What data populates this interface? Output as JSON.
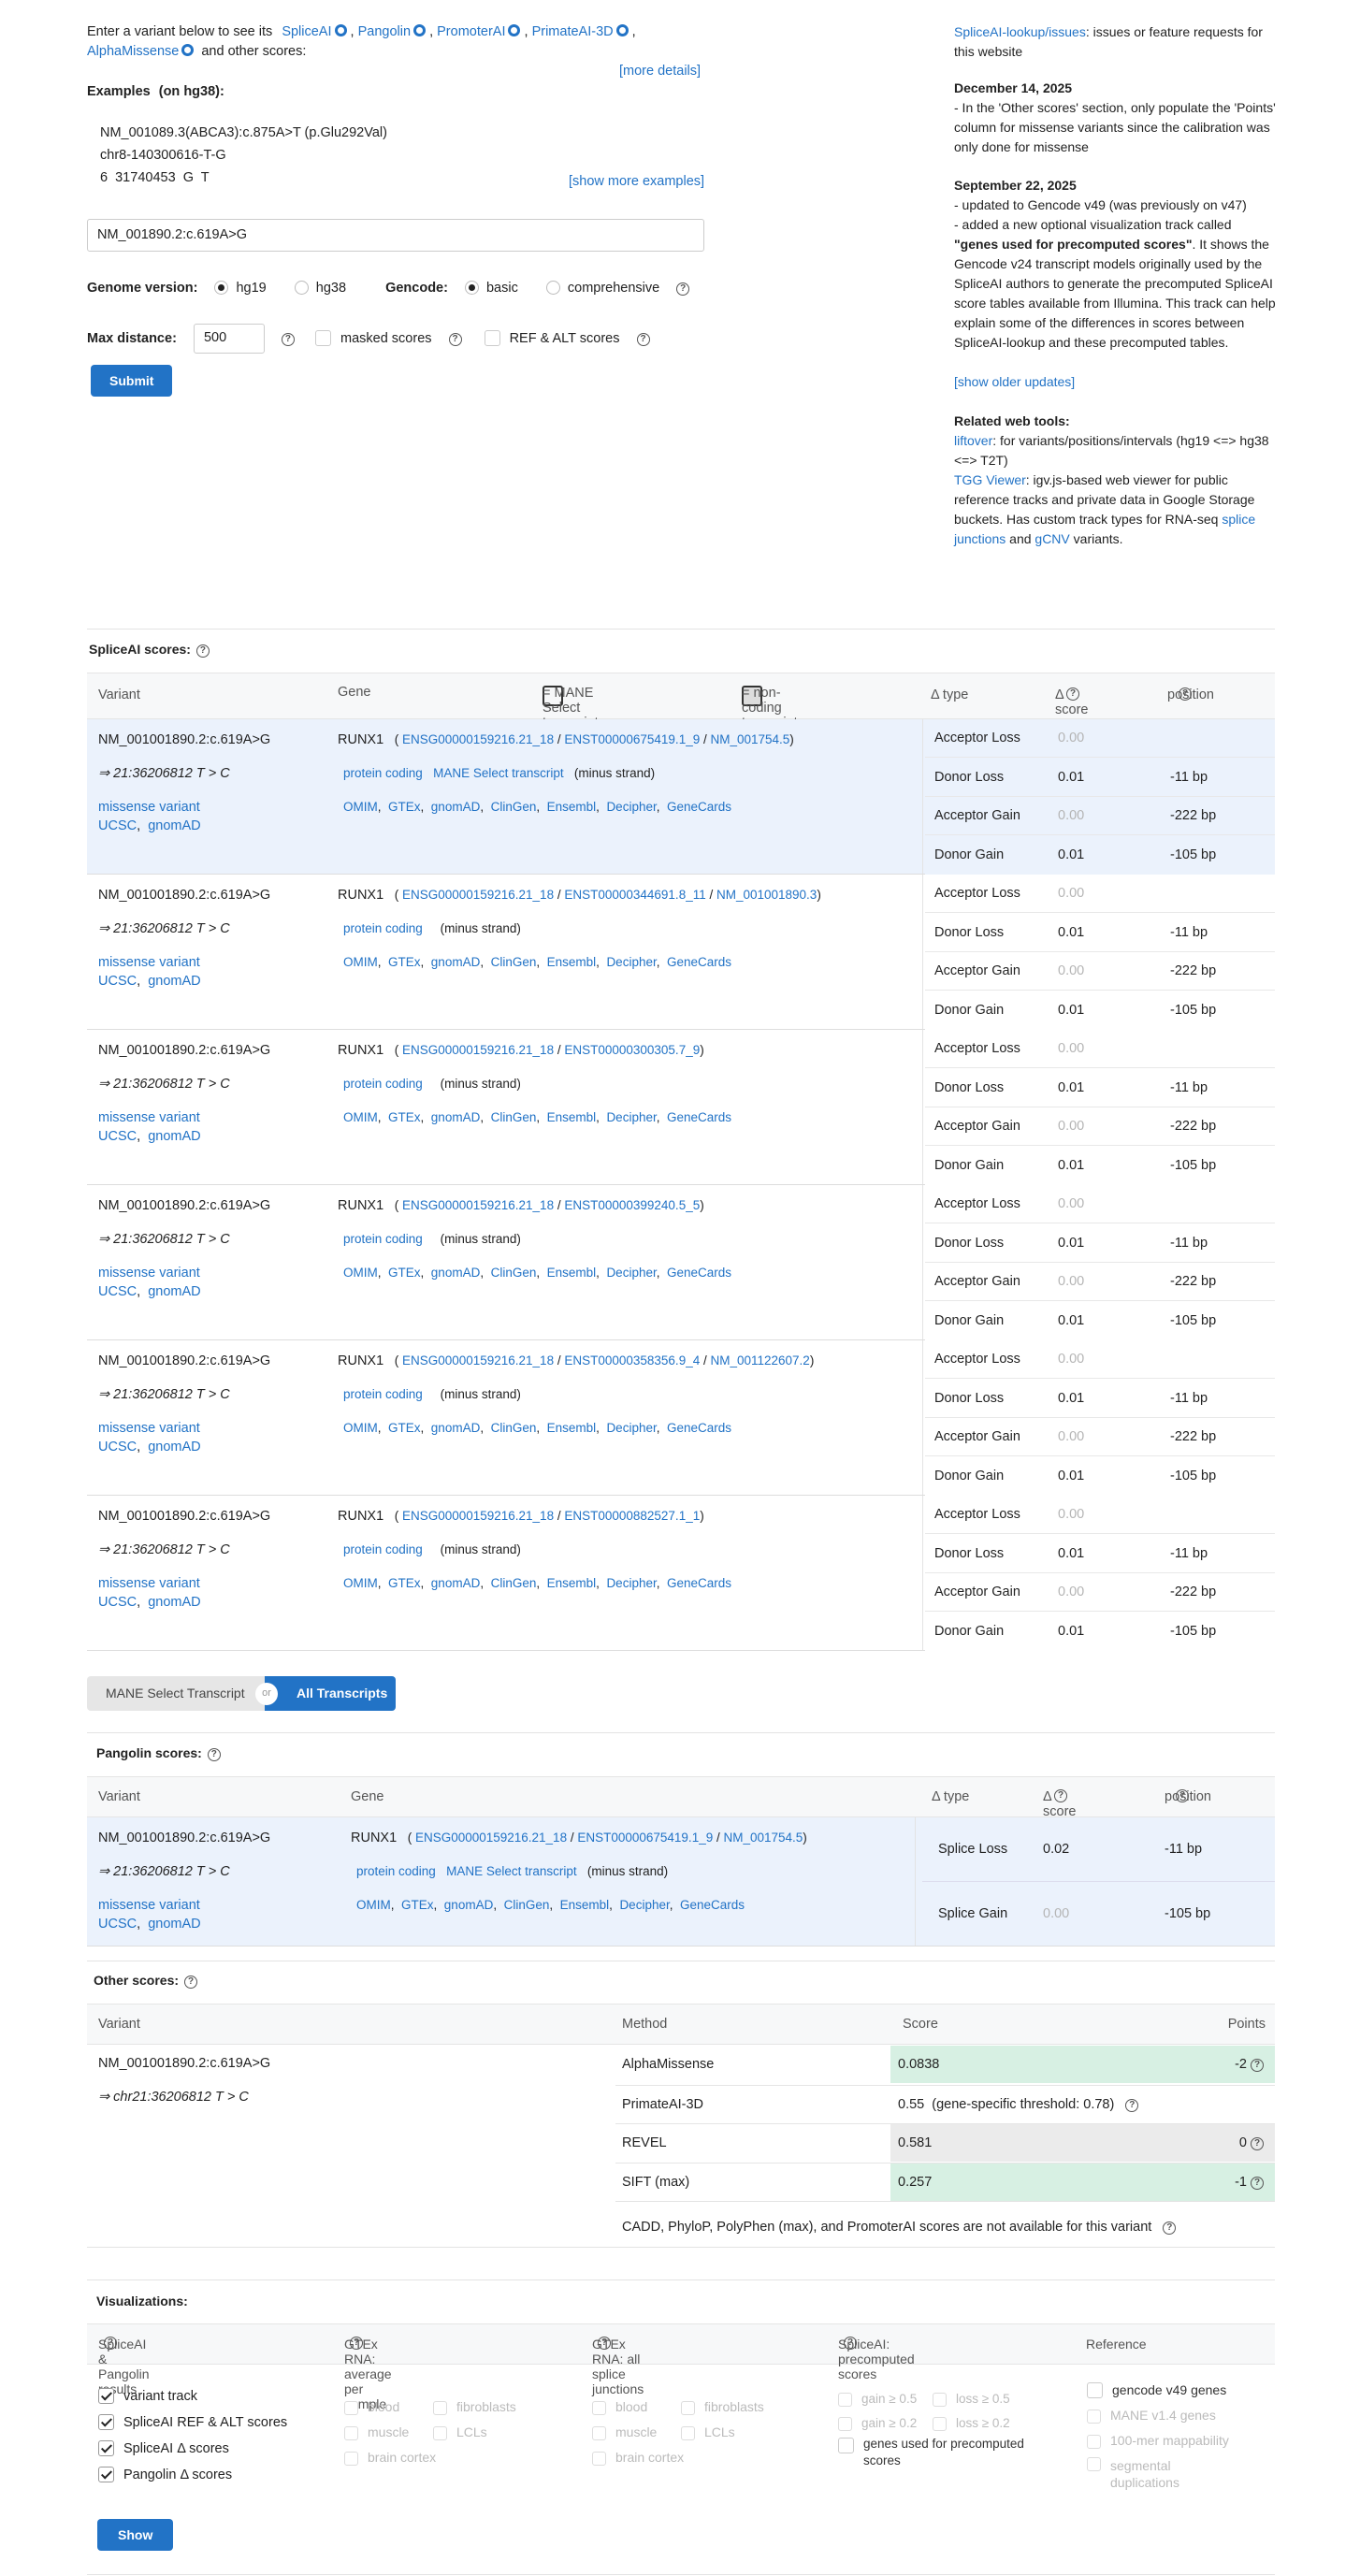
{
  "intro": {
    "prefix": "Enter a variant below to see its",
    "tools": [
      "SpliceAI",
      "Pangolin",
      "PromoterAI",
      "PrimateAI-3D",
      "AlphaMissense"
    ],
    "suffix": "and other scores:",
    "more_details": "[more details]"
  },
  "examples": {
    "heading": "Examples",
    "heading_note": "(on hg38):",
    "items": [
      "NM_001089.3(ABCA3):c.875A>T (p.Glu292Val)",
      "chr8-140300616-T-G",
      "6  31740453  G  T"
    ],
    "show_more": "[show more examples]"
  },
  "search": {
    "value": "NM_001890.2:c.619A>G"
  },
  "options": {
    "genome_label": "Genome version:",
    "genome_choices": [
      "hg19",
      "hg38"
    ],
    "genome_selected": "hg19",
    "gencode_label": "Gencode:",
    "gencode_choices": [
      "basic",
      "comprehensive"
    ],
    "gencode_selected": "basic",
    "maxdist_label": "Max distance:",
    "maxdist_value": "500",
    "masked_label": "masked scores",
    "refalt_label": "REF & ALT scores",
    "submit": "Submit"
  },
  "news": {
    "issues_link": "SpliceAI-lookup/issues",
    "issues_text": ": issues or feature requests for this website",
    "update1_date": "December 14, 2025",
    "update1_text": "- In the 'Other scores' section, only populate the 'Points' column for missense variants since the calibration was only done for missense",
    "update2_date": "September 22, 2025",
    "update2_line1": "- updated to Gencode v49 (was previously on v47)",
    "update2_line2a": "- added a new optional visualization track called",
    "update2_bold": "\"genes used for precomputed scores\"",
    "update2_line2b": ". It shows the Gencode v24 transcript models originally used by the SpliceAI authors to generate the precomputed SpliceAI score tables available from Illumina. This track can help explain some of the differences in scores between SpliceAI-lookup and these precomputed tables.",
    "show_older": "[show older updates]",
    "related_heading": "Related web tools:",
    "liftover": "liftover",
    "liftover_text": ": for variants/positions/intervals (hg19 <=> hg38 <=> T2T)",
    "tgg": "TGG Viewer",
    "tgg_text": ": igv.js-based web viewer for public reference tracks and private data in Google Storage buckets. Has custom track types for RNA-seq",
    "splice_junctions": "splice junctions",
    "and": "and",
    "gcnv": "gCNV",
    "variants": "variants."
  },
  "spliceai": {
    "title": "SpliceAI scores:",
    "col_variant": "Variant",
    "col_gene": "Gene",
    "legend_mane": "= MANE Select transcript",
    "legend_noncoding": "= non-coding transcript",
    "col_type": "Δ type",
    "col_score": "Δ score",
    "col_position": "position",
    "rows": [
      {
        "variant": "NM_001001890.2:c.619A>G",
        "hgvs": "⇒ 21:36206812 T > C",
        "consequence": "missense variant",
        "gene": "RUNX1",
        "ids": [
          "ENSG00000159216.21_18",
          "ENST00000675419.1_9",
          "NM_001754.5"
        ],
        "biotype": "protein coding",
        "mane": "MANE Select transcript",
        "strand": "(minus strand)",
        "scores": [
          {
            "type": "Acceptor Loss",
            "score": "0.00",
            "pos": ""
          },
          {
            "type": "Donor Loss",
            "score": "0.01",
            "pos": "-11 bp"
          },
          {
            "type": "Acceptor Gain",
            "score": "0.00",
            "pos": "-222 bp"
          },
          {
            "type": "Donor Gain",
            "score": "0.01",
            "pos": "-105 bp"
          }
        ]
      },
      {
        "variant": "NM_001001890.2:c.619A>G",
        "hgvs": "⇒ 21:36206812 T > C",
        "consequence": "missense variant",
        "gene": "RUNX1",
        "ids": [
          "ENSG00000159216.21_18",
          "ENST00000344691.8_11",
          "NM_001001890.3"
        ],
        "biotype": "protein coding",
        "mane": "",
        "strand": "(minus strand)",
        "scores": [
          {
            "type": "Acceptor Loss",
            "score": "0.00",
            "pos": ""
          },
          {
            "type": "Donor Loss",
            "score": "0.01",
            "pos": "-11 bp"
          },
          {
            "type": "Acceptor Gain",
            "score": "0.00",
            "pos": "-222 bp"
          },
          {
            "type": "Donor Gain",
            "score": "0.01",
            "pos": "-105 bp"
          }
        ]
      },
      {
        "variant": "NM_001001890.2:c.619A>G",
        "hgvs": "⇒ 21:36206812 T > C",
        "consequence": "missense variant",
        "gene": "RUNX1",
        "ids": [
          "ENSG00000159216.21_18",
          "ENST00000300305.7_9"
        ],
        "biotype": "protein coding",
        "mane": "",
        "strand": "(minus strand)",
        "scores": [
          {
            "type": "Acceptor Loss",
            "score": "0.00",
            "pos": ""
          },
          {
            "type": "Donor Loss",
            "score": "0.01",
            "pos": "-11 bp"
          },
          {
            "type": "Acceptor Gain",
            "score": "0.00",
            "pos": "-222 bp"
          },
          {
            "type": "Donor Gain",
            "score": "0.01",
            "pos": "-105 bp"
          }
        ]
      },
      {
        "variant": "NM_001001890.2:c.619A>G",
        "hgvs": "⇒ 21:36206812 T > C",
        "consequence": "missense variant",
        "gene": "RUNX1",
        "ids": [
          "ENSG00000159216.21_18",
          "ENST00000399240.5_5"
        ],
        "biotype": "protein coding",
        "mane": "",
        "strand": "(minus strand)",
        "scores": [
          {
            "type": "Acceptor Loss",
            "score": "0.00",
            "pos": ""
          },
          {
            "type": "Donor Loss",
            "score": "0.01",
            "pos": "-11 bp"
          },
          {
            "type": "Acceptor Gain",
            "score": "0.00",
            "pos": "-222 bp"
          },
          {
            "type": "Donor Gain",
            "score": "0.01",
            "pos": "-105 bp"
          }
        ]
      },
      {
        "variant": "NM_001001890.2:c.619A>G",
        "hgvs": "⇒ 21:36206812 T > C",
        "consequence": "missense variant",
        "gene": "RUNX1",
        "ids": [
          "ENSG00000159216.21_18",
          "ENST00000358356.9_4",
          "NM_001122607.2"
        ],
        "biotype": "protein coding",
        "mane": "",
        "strand": "(minus strand)",
        "scores": [
          {
            "type": "Acceptor Loss",
            "score": "0.00",
            "pos": ""
          },
          {
            "type": "Donor Loss",
            "score": "0.01",
            "pos": "-11 bp"
          },
          {
            "type": "Acceptor Gain",
            "score": "0.00",
            "pos": "-222 bp"
          },
          {
            "type": "Donor Gain",
            "score": "0.01",
            "pos": "-105 bp"
          }
        ]
      },
      {
        "variant": "NM_001001890.2:c.619A>G",
        "hgvs": "⇒ 21:36206812 T > C",
        "consequence": "missense variant",
        "gene": "RUNX1",
        "ids": [
          "ENSG00000159216.21_18",
          "ENST00000882527.1_1"
        ],
        "biotype": "protein coding",
        "mane": "",
        "strand": "(minus strand)",
        "scores": [
          {
            "type": "Acceptor Loss",
            "score": "0.00",
            "pos": ""
          },
          {
            "type": "Donor Loss",
            "score": "0.01",
            "pos": "-11 bp"
          },
          {
            "type": "Acceptor Gain",
            "score": "0.00",
            "pos": "-222 bp"
          },
          {
            "type": "Donor Gain",
            "score": "0.01",
            "pos": "-105 bp"
          }
        ]
      }
    ],
    "ext_links": [
      "OMIM",
      "GTEx",
      "gnomAD",
      "ClinGen",
      "Ensembl",
      "Decipher",
      "GeneCards"
    ],
    "variant_links": [
      "UCSC",
      "gnomAD"
    ]
  },
  "toggle": {
    "mane": "MANE Select Transcript",
    "or": "or",
    "all": "All Transcripts"
  },
  "pangolin": {
    "title": "Pangolin scores:",
    "col_variant": "Variant",
    "col_gene": "Gene",
    "col_type": "Δ type",
    "col_score": "Δ score",
    "col_position": "position",
    "variant": "NM_001001890.2:c.619A>G",
    "hgvs": "⇒ 21:36206812 T > C",
    "consequence": "missense variant",
    "gene": "RUNX1",
    "ids": [
      "ENSG00000159216.21_18",
      "ENST00000675419.1_9",
      "NM_001754.5"
    ],
    "biotype": "protein coding",
    "mane": "MANE Select transcript",
    "strand": "(minus strand)",
    "scores": [
      {
        "type": "Splice Loss",
        "score": "0.02",
        "pos": "-11 bp"
      },
      {
        "type": "Splice Gain",
        "score": "0.00",
        "pos": "-105 bp"
      }
    ]
  },
  "other": {
    "title": "Other scores:",
    "col_variant": "Variant",
    "col_method": "Method",
    "col_score": "Score",
    "col_points": "Points",
    "variant": "NM_001001890.2:c.619A>G",
    "hgvs": "⇒ chr21:36206812 T > C",
    "methods": [
      {
        "name": "AlphaMissense",
        "score": "0.0838",
        "points": "-2"
      },
      {
        "name": "PrimateAI-3D",
        "score": "0.55  (gene-specific threshold: 0.78)",
        "points": ""
      },
      {
        "name": "REVEL",
        "score": "0.581",
        "points": "0"
      },
      {
        "name": "SIFT (max)",
        "score": "0.257",
        "points": "-1"
      }
    ],
    "na_note": "CADD,  PhyloP,  PolyPhen (max),  and PromoterAI scores are not available for this variant"
  },
  "viz": {
    "title": "Visualizations:",
    "col1": "SpliceAI & Pangolin results",
    "col2": "GTEx RNA: average per sample",
    "col3": "GTEx RNA: all splice junctions",
    "col4": "SpliceAI: precomputed scores",
    "col5": "Reference",
    "col1_items": [
      "variant track",
      "SpliceAI REF & ALT scores",
      "SpliceAI Δ scores",
      "Pangolin Δ scores"
    ],
    "tissues": [
      "blood",
      "fibroblasts",
      "muscle",
      "LCLs",
      "brain cortex"
    ],
    "pre_items": [
      "gain ≥ 0.5",
      "loss ≥ 0.5",
      "gain ≥ 0.2",
      "loss ≥ 0.2",
      "genes used for precomputed scores"
    ],
    "ref_items": [
      "gencode v49 genes",
      "MANE v1.4 genes",
      "100-mer mappability",
      "segmental duplications"
    ],
    "show": "Show"
  }
}
